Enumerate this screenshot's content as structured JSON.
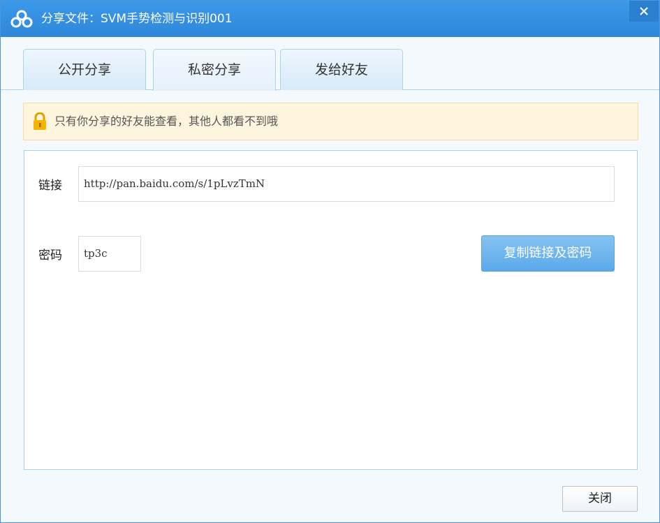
{
  "window": {
    "title": "分享文件：SVM手势检测与识别001",
    "icon": "baidu-cloud-logo",
    "accent_color": "#2f88db"
  },
  "titlebar": {
    "close_icon": "close-icon"
  },
  "tabs": [
    {
      "label": "公开分享",
      "active": false
    },
    {
      "label": "私密分享",
      "active": true
    },
    {
      "label": "发给好友",
      "active": false
    }
  ],
  "notice": {
    "icon": "lock-icon",
    "text": "只有你分享的好友能查看，其他人都看不到哦"
  },
  "form": {
    "link_label": "链接",
    "link_value": "http://pan.baidu.com/s/1pLvzTmN",
    "password_label": "密码",
    "password_value": "tp3c",
    "copy_button": "复制链接及密码"
  },
  "footer": {
    "close_button": "关闭"
  }
}
